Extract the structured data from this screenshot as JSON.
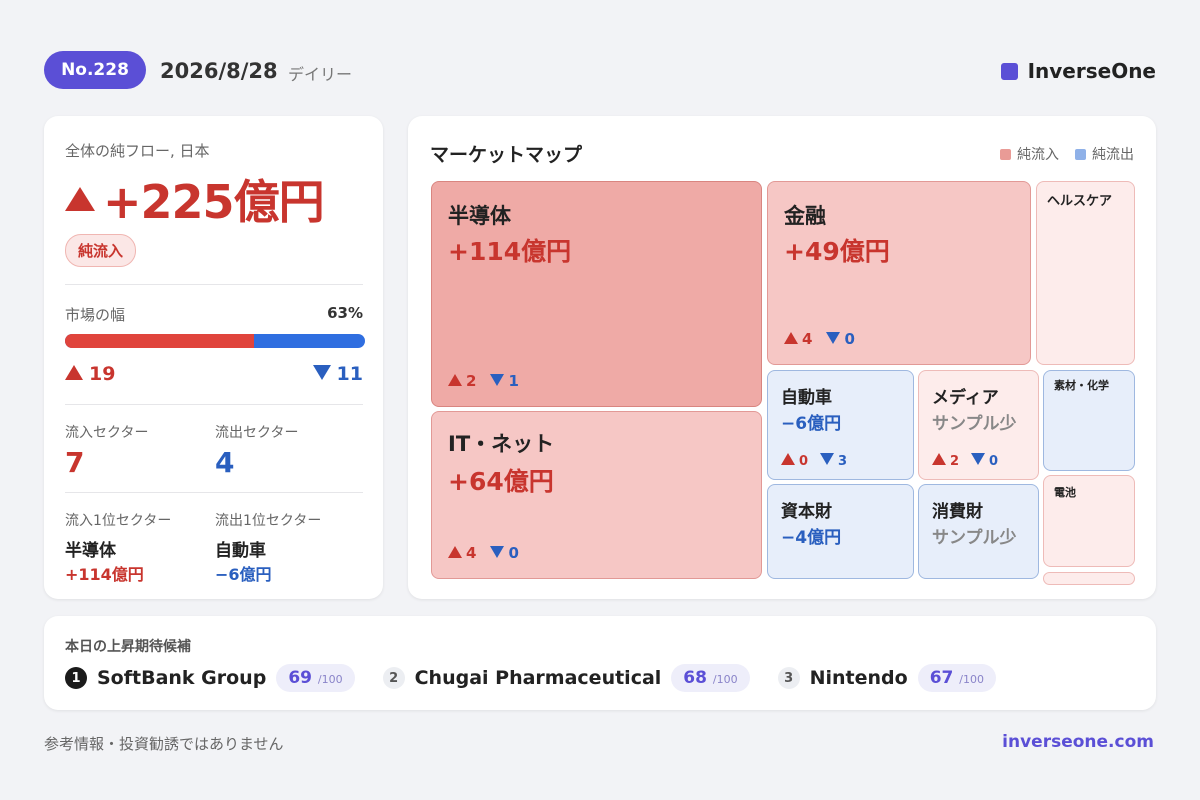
{
  "header": {
    "issue": "No.228",
    "date": "2026/8/28",
    "type": "デイリー",
    "brand": "InverseOne"
  },
  "summary": {
    "label": "全体の純フロー, 日本",
    "total": "+225億円",
    "status": "純流入",
    "breadth_label": "市場の幅",
    "breadth_pct": "63%",
    "breadth_fraction": 0.63,
    "up_count": "19",
    "down_count": "11",
    "inflow_sectors_label": "流入セクター",
    "inflow_sectors": "7",
    "outflow_sectors_label": "流出セクター",
    "outflow_sectors": "4",
    "top_in_label": "流入1位セクター",
    "top_in_name": "半導体",
    "top_in_value": "+114億円",
    "top_out_label": "流出1位セクター",
    "top_out_name": "自動車",
    "top_out_value": "−6億円"
  },
  "market_map": {
    "title": "マーケットマップ",
    "legend_in": "純流入",
    "legend_out": "純流出",
    "color_in": "#efaaa6",
    "color_out": "#9fb8e0",
    "tiles": {
      "semi": {
        "name": "半導体",
        "value": "+114億円",
        "up": "2",
        "down": "1"
      },
      "it": {
        "name": "IT・ネット",
        "value": "+64億円",
        "up": "4",
        "down": "0"
      },
      "fin": {
        "name": "金融",
        "value": "+49億円",
        "up": "4",
        "down": "0"
      },
      "health": {
        "name": "ヘルスケア"
      },
      "auto": {
        "name": "自動車",
        "value": "−6億円",
        "up": "0",
        "down": "3"
      },
      "media": {
        "name": "メディア",
        "value": "サンプル少",
        "up": "2",
        "down": "0"
      },
      "material": {
        "name": "素材・化学"
      },
      "capital": {
        "name": "資本財",
        "value": "−4億円"
      },
      "consumer": {
        "name": "消費財",
        "value": "サンプル少"
      },
      "battery": {
        "name": "電池"
      }
    }
  },
  "candidates": {
    "title": "本日の上昇期待候補",
    "items": [
      {
        "rank": "1",
        "name": "SoftBank Group",
        "score": "69",
        "max": "/100"
      },
      {
        "rank": "2",
        "name": "Chugai Pharmaceutical",
        "score": "68",
        "max": "/100"
      },
      {
        "rank": "3",
        "name": "Nintendo",
        "score": "67",
        "max": "/100"
      }
    ]
  },
  "footer": {
    "disclaimer": "参考情報・投資勧誘ではありません",
    "site": "inverseone.com"
  }
}
